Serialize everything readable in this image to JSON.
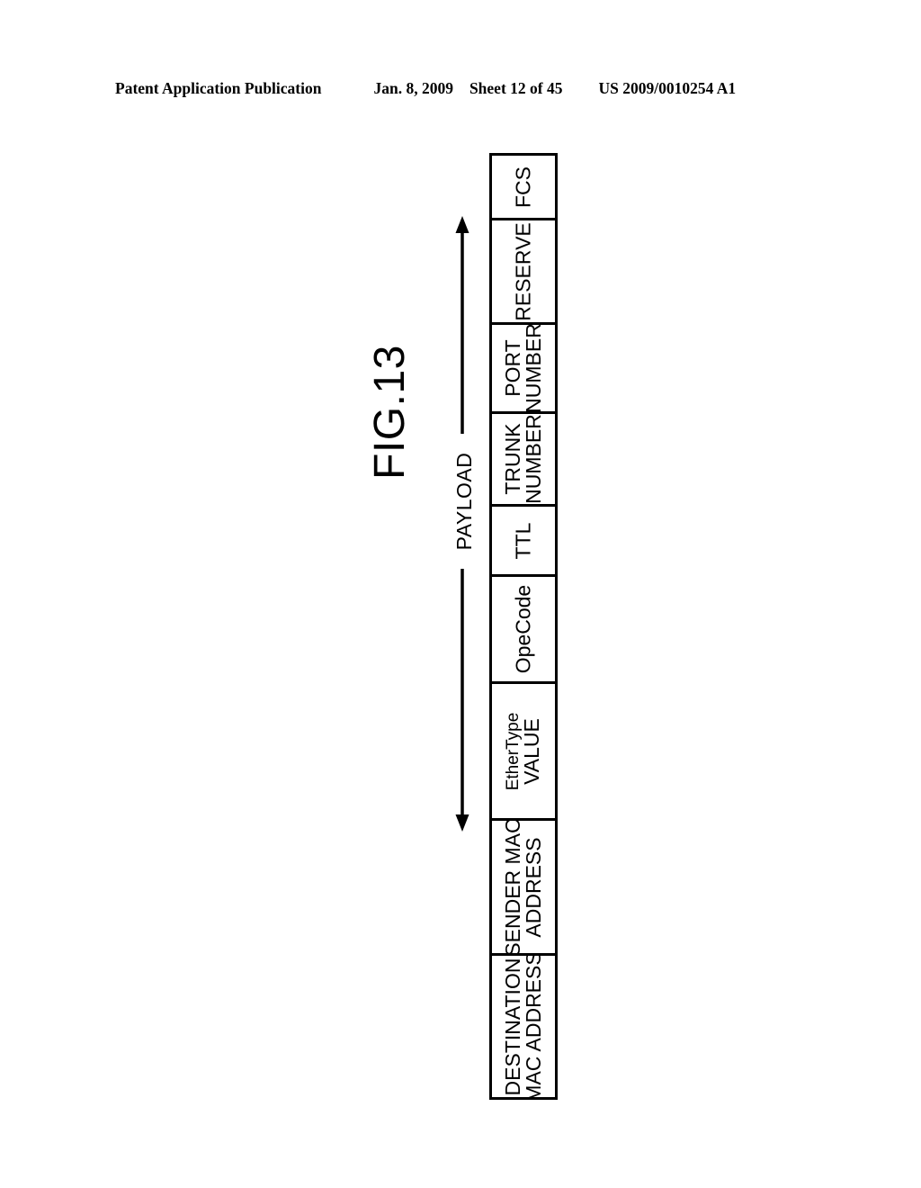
{
  "header": {
    "publication": "Patent Application Publication",
    "date": "Jan. 8, 2009",
    "sheet": "Sheet 12 of 45",
    "patent_number": "US 2009/0010254 A1"
  },
  "figure": {
    "title": "FIG.13",
    "payload_label": "PAYLOAD",
    "fields": [
      {
        "lines": [
          "FCS"
        ],
        "style": "big"
      },
      {
        "lines": [
          "RESERVE"
        ],
        "style": "big"
      },
      {
        "lines": [
          "PORT",
          "NUMBER"
        ],
        "style": "big"
      },
      {
        "lines": [
          "TRUNK",
          "NUMBER"
        ],
        "style": "big"
      },
      {
        "lines": [
          "TTL"
        ],
        "style": "big"
      },
      {
        "lines": [
          "OpeCode"
        ],
        "style": "big"
      },
      {
        "lines": [
          "EtherType",
          "VALUE"
        ],
        "style": "mixed"
      },
      {
        "lines": [
          "SENDER MAC",
          "ADDRESS"
        ],
        "style": "big"
      },
      {
        "lines": [
          "DESTINATION",
          "MAC ADDRESS"
        ],
        "style": "big"
      }
    ]
  },
  "colors": {
    "ink": "#000000",
    "paper": "#ffffff"
  }
}
